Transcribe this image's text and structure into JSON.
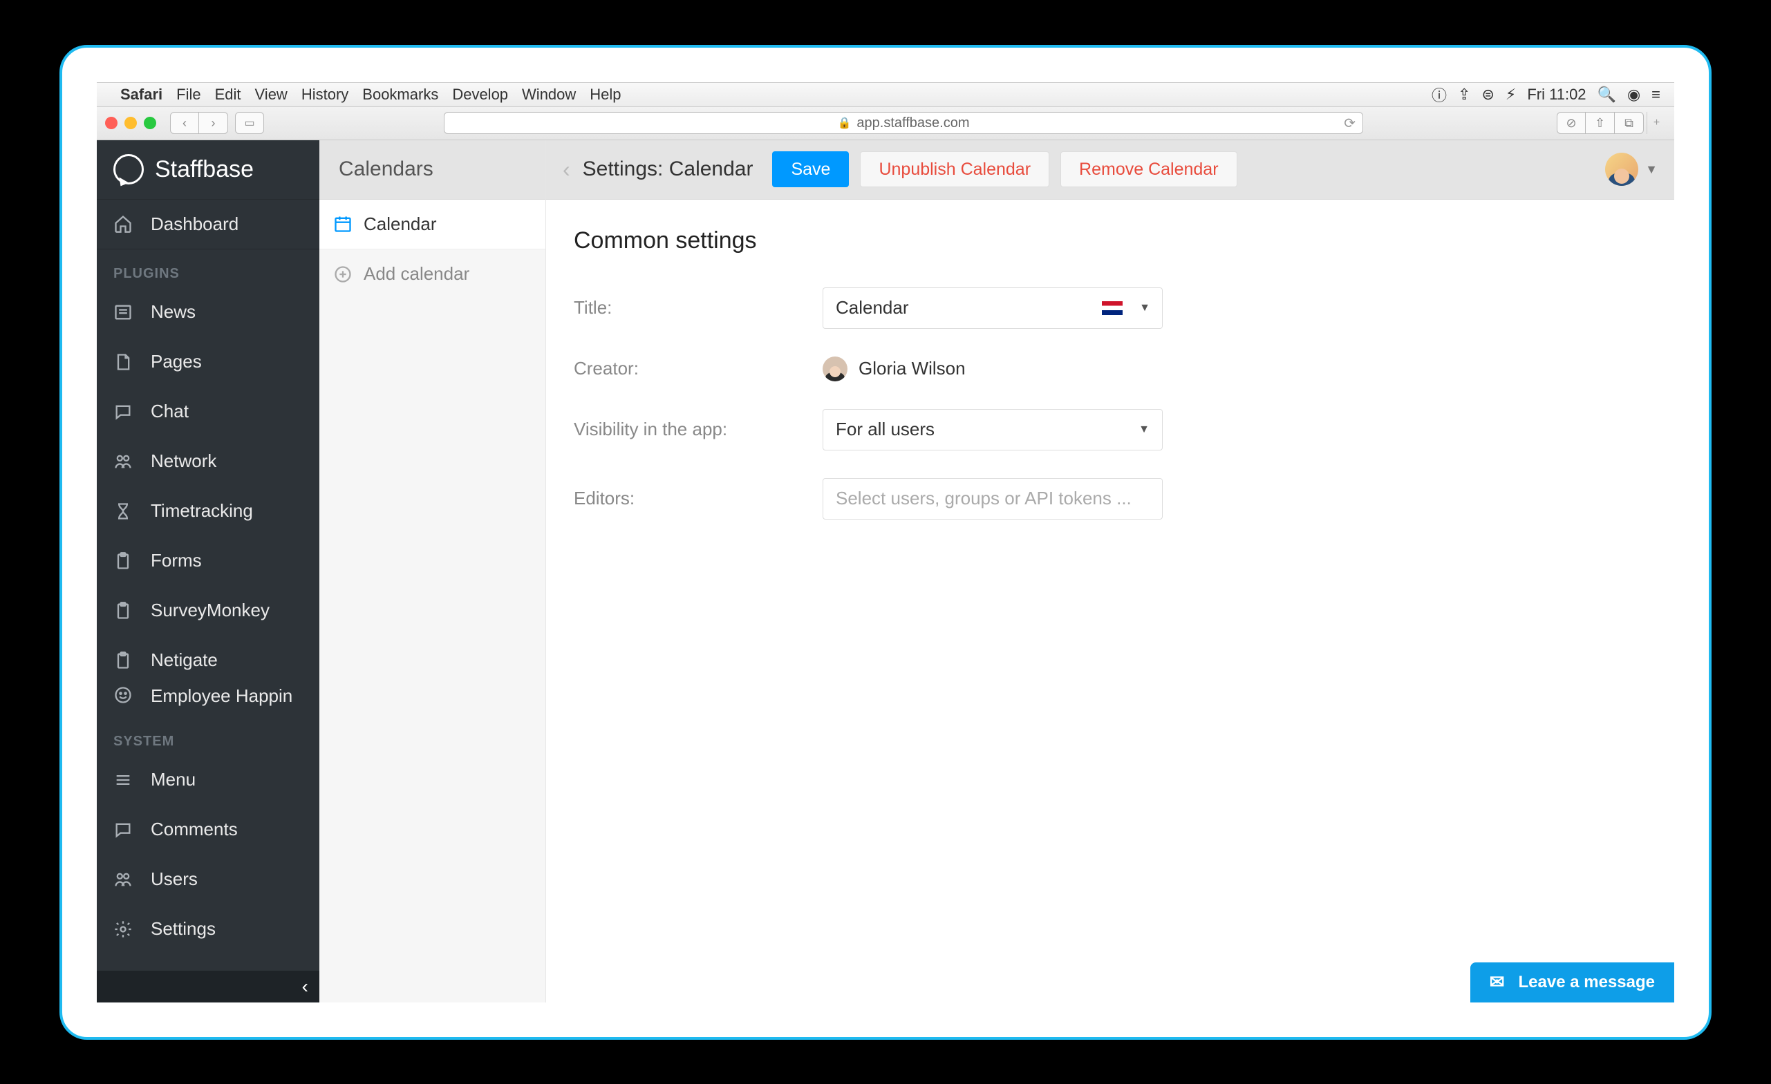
{
  "macMenu": {
    "appName": "Safari",
    "items": [
      "File",
      "Edit",
      "View",
      "History",
      "Bookmarks",
      "Develop",
      "Window",
      "Help"
    ],
    "clock": "Fri 11:02"
  },
  "browser": {
    "url": "app.staffbase.com"
  },
  "brand": {
    "name": "Staffbase"
  },
  "sidebar": {
    "dashboard": "Dashboard",
    "pluginsHeading": "PLUGINS",
    "systemHeading": "SYSTEM",
    "plugins": [
      {
        "label": "News"
      },
      {
        "label": "Pages"
      },
      {
        "label": "Chat"
      },
      {
        "label": "Network"
      },
      {
        "label": "Timetracking"
      },
      {
        "label": "Forms"
      },
      {
        "label": "SurveyMonkey"
      },
      {
        "label": "Netigate"
      },
      {
        "label": "Employee Happin"
      }
    ],
    "system": [
      {
        "label": "Menu"
      },
      {
        "label": "Comments"
      },
      {
        "label": "Users"
      },
      {
        "label": "Settings"
      }
    ]
  },
  "secondary": {
    "heading": "Calendars",
    "items": [
      {
        "label": "Calendar"
      }
    ],
    "addLabel": "Add calendar"
  },
  "topbar": {
    "title": "Settings: Calendar",
    "save": "Save",
    "unpublish": "Unpublish Calendar",
    "remove": "Remove Calendar"
  },
  "form": {
    "heading": "Common settings",
    "titleLabel": "Title:",
    "titleValue": "Calendar",
    "creatorLabel": "Creator:",
    "creatorName": "Gloria Wilson",
    "visibilityLabel": "Visibility in the app:",
    "visibilityValue": "For all users",
    "editorsLabel": "Editors:",
    "editorsPlaceholder": "Select users, groups or API tokens ..."
  },
  "messageWidget": "Leave a message"
}
